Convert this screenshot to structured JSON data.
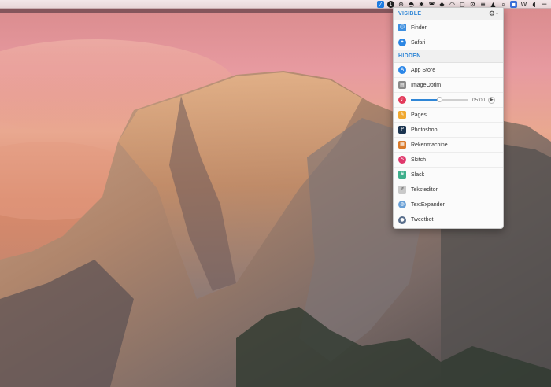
{
  "menubar": {
    "tray_icons": [
      "bartender-icon",
      "1password-icon",
      "creative-cloud-icon",
      "tweetbot-icon",
      "bluetooth-icon",
      "messages-icon",
      "dropbox-icon",
      "wifi-icon",
      "sound-icon",
      "gear-icon",
      "notes-icon",
      "hat-icon",
      "spotlight-icon",
      "blank-icon",
      "wunderlist-icon",
      "tag-icon",
      "notifications-icon"
    ]
  },
  "panel": {
    "visible_section": {
      "title": "VISIBLE",
      "items": [
        {
          "label": "Finder",
          "icon": "finder-icon",
          "color": "#3d8fe0"
        },
        {
          "label": "Safari",
          "icon": "safari-icon",
          "color": "#2b86e3"
        }
      ]
    },
    "hidden_section": {
      "title": "HIDDEN",
      "items": [
        {
          "label": "App Store",
          "icon": "app-store-icon",
          "color": "#2c87e8"
        },
        {
          "label": "ImageOptim",
          "icon": "imageoptim-icon",
          "color": "#8a8a8a"
        }
      ],
      "player": {
        "time": "05:00",
        "progress": 0.5,
        "icon": "itunes-icon",
        "color": "#e33a5a"
      },
      "items_after_player": [
        {
          "label": "Pages",
          "icon": "pages-icon",
          "color": "#f0a830"
        },
        {
          "label": "Photoshop",
          "icon": "photoshop-icon",
          "color": "#1b3450"
        },
        {
          "label": "Rekenmachine",
          "icon": "calculator-icon",
          "color": "#d97a2b"
        },
        {
          "label": "Skitch",
          "icon": "skitch-icon",
          "color": "#e0386c"
        },
        {
          "label": "Slack",
          "icon": "slack-icon",
          "color": "#3fae8b"
        },
        {
          "label": "Teksteditor",
          "icon": "texteditor-icon",
          "color": "#c9c9c9"
        },
        {
          "label": "TextExpander",
          "icon": "textexpander-icon",
          "color": "#6aa0d6"
        },
        {
          "label": "Tweetbot",
          "icon": "tweetbot-icon",
          "color": "#5a6f8c"
        }
      ]
    }
  }
}
